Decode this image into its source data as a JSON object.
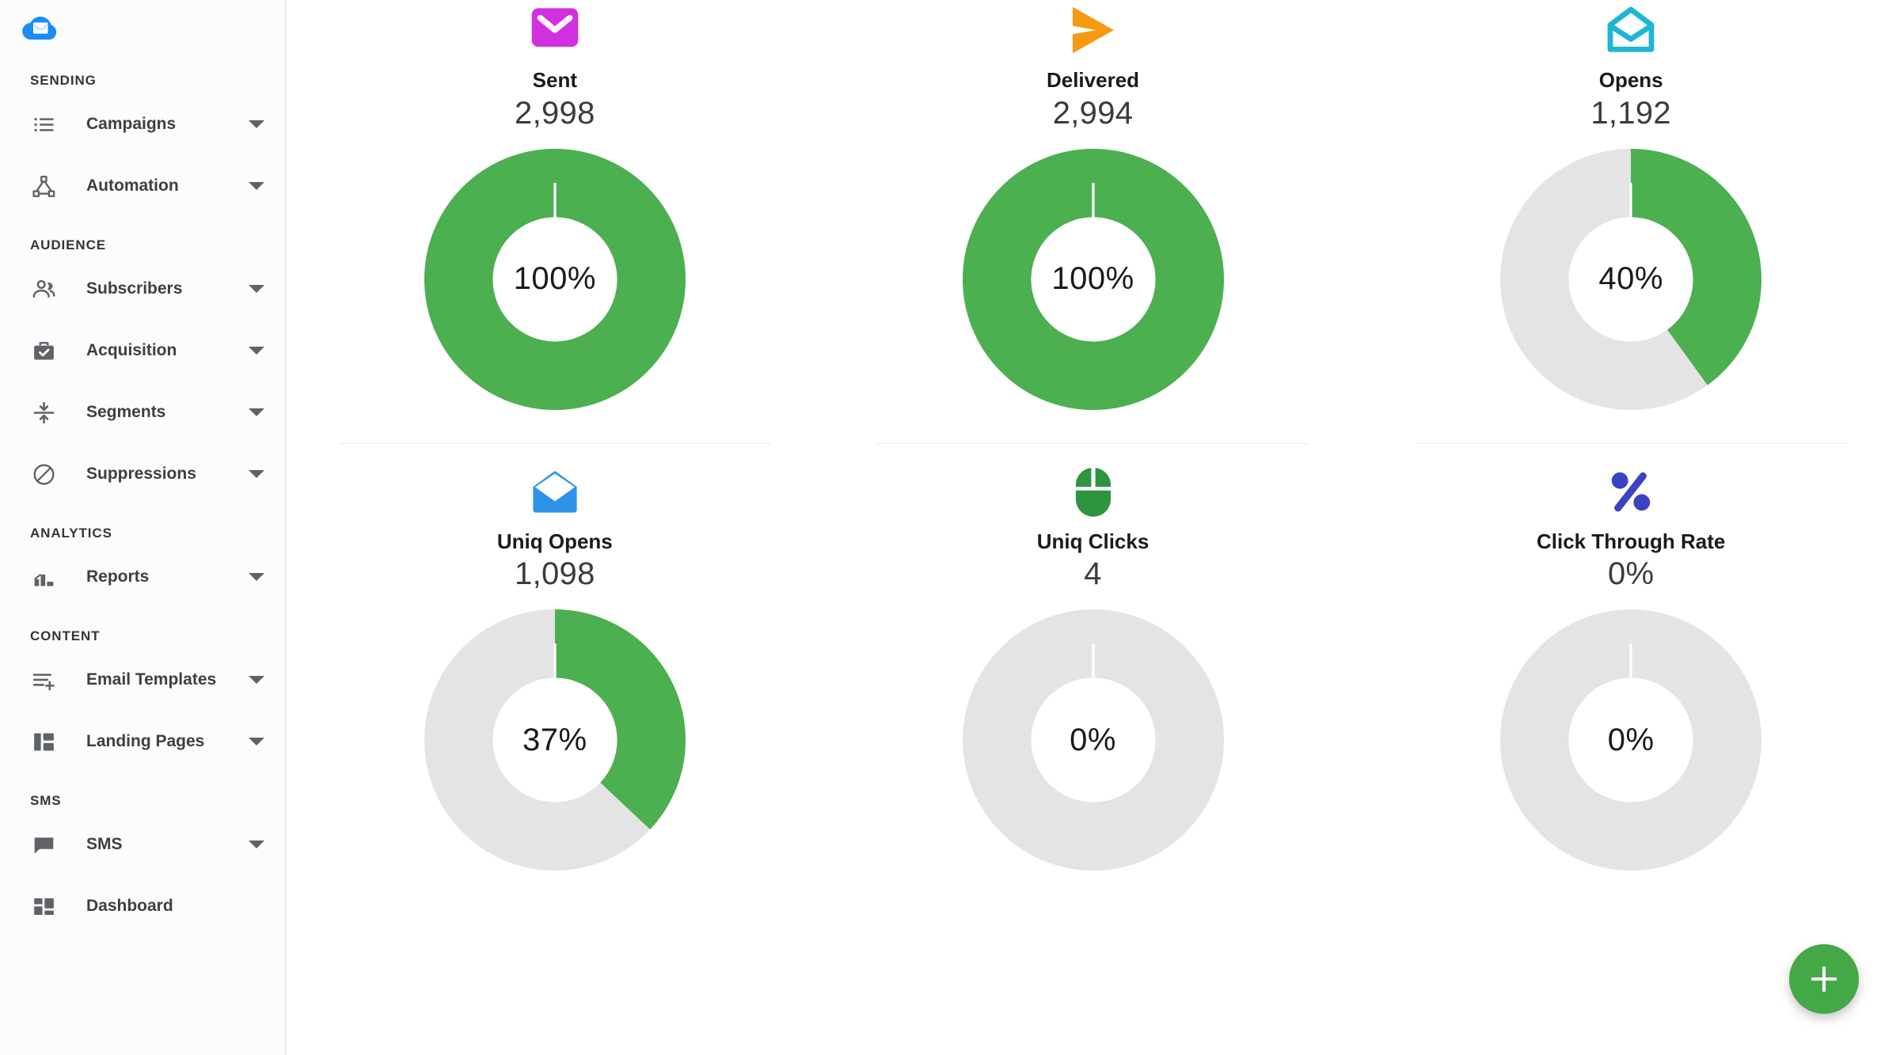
{
  "app": {
    "logo_name": "cloud-mail-logo",
    "accent_green": "#4caf50",
    "track_grey": "#e4e4e4",
    "fab_color": "#45a846"
  },
  "sidebar": {
    "sections": [
      {
        "label": "SENDING",
        "items": [
          {
            "label": "Campaigns",
            "icon": "list-icon",
            "has_caret": true
          },
          {
            "label": "Automation",
            "icon": "automation-flow-icon",
            "has_caret": true
          }
        ]
      },
      {
        "label": "AUDIENCE",
        "items": [
          {
            "label": "Subscribers",
            "icon": "people-icon",
            "has_caret": true
          },
          {
            "label": "Acquisition",
            "icon": "briefcase-check-icon",
            "has_caret": true
          },
          {
            "label": "Segments",
            "icon": "segments-arrows-icon",
            "has_caret": true
          },
          {
            "label": "Suppressions",
            "icon": "block-circle-icon",
            "has_caret": true
          }
        ]
      },
      {
        "label": "ANALYTICS",
        "items": [
          {
            "label": "Reports",
            "icon": "bar-chart-icon",
            "has_caret": true
          }
        ]
      },
      {
        "label": "CONTENT",
        "items": [
          {
            "label": "Email Templates",
            "icon": "template-plus-icon",
            "has_caret": true
          },
          {
            "label": "Landing Pages",
            "icon": "layout-columns-icon",
            "has_caret": true
          }
        ]
      },
      {
        "label": "SMS",
        "items": [
          {
            "label": "SMS",
            "icon": "chat-bubble-icon",
            "has_caret": true
          },
          {
            "label": "Dashboard",
            "icon": "dashboard-grid-icon",
            "has_caret": false
          }
        ]
      }
    ]
  },
  "fab": {
    "label": "+",
    "name": "add-button"
  },
  "chart_data": {
    "type": "pie",
    "title": "Campaign performance donuts",
    "legend": "none",
    "metrics": [
      {
        "label": "Sent",
        "value": "2,998",
        "percent": 100,
        "percent_label": "100%",
        "icon": "envelope-filled-icon",
        "icon_color": "#d22fe0"
      },
      {
        "label": "Delivered",
        "value": "2,994",
        "percent": 100,
        "percent_label": "100%",
        "icon": "send-plane-icon",
        "icon_color": "#f59a11"
      },
      {
        "label": "Opens",
        "value": "1,192",
        "percent": 40,
        "percent_label": "40%",
        "icon": "envelope-open-outline-icon",
        "icon_color": "#1fb6d4"
      },
      {
        "label": "Uniq Opens",
        "value": "1,098",
        "percent": 37,
        "percent_label": "37%",
        "icon": "envelope-open-filled-icon",
        "icon_color": "#2d93e8"
      },
      {
        "label": "Uniq Clicks",
        "value": "4",
        "percent": 0,
        "percent_label": "0%",
        "icon": "mouse-icon",
        "icon_color": "#2e9440"
      },
      {
        "label": "Click Through Rate",
        "value": "0%",
        "percent": 0,
        "percent_label": "0%",
        "icon": "percent-icon",
        "icon_color": "#3b42c4"
      }
    ],
    "series": [
      {
        "name": "percent",
        "values": [
          100,
          100,
          40,
          37,
          0,
          0
        ]
      }
    ],
    "categories": [
      "Sent",
      "Delivered",
      "Opens",
      "Uniq Opens",
      "Uniq Clicks",
      "Click Through Rate"
    ],
    "counts": [
      2998,
      2994,
      1192,
      1098,
      4,
      0
    ]
  }
}
